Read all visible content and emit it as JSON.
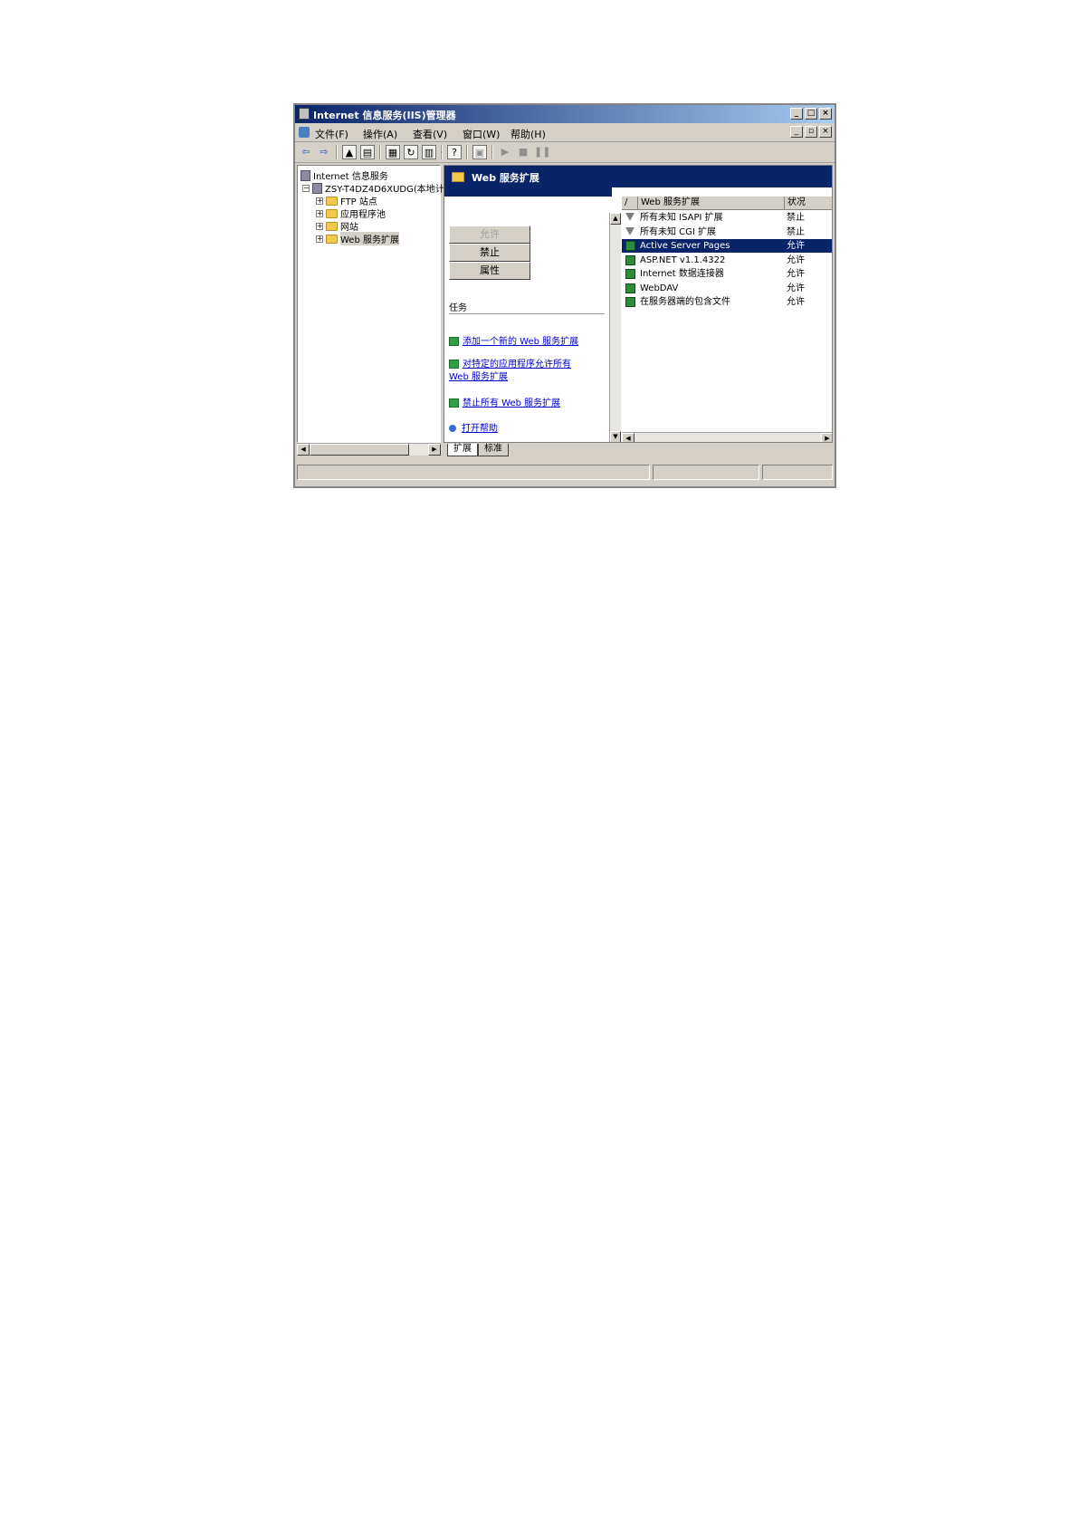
{
  "window": {
    "title": "Internet 信息服务(IIS)管理器",
    "title_buttons": [
      "_",
      "□",
      "×"
    ]
  },
  "menu": {
    "items": [
      "文件(F)",
      "操作(A)",
      "查看(V)",
      "窗口(W)",
      "帮助(H)"
    ],
    "child_buttons": [
      "_",
      "▫",
      "×"
    ]
  },
  "toolbar": {
    "icons": [
      "back-arrow-icon",
      "forward-arrow-icon",
      "up-folder-icon",
      "show-hide-tree-icon",
      "properties-icon",
      "refresh-icon",
      "export-list-icon",
      "help-icon",
      "new-window-icon",
      "play-icon",
      "stop-icon",
      "pause-icon"
    ]
  },
  "tree": {
    "root": "Internet 信息服务",
    "server": "ZSY-T4DZ4D6XUDG(本地计",
    "children": [
      "FTP 站点",
      "应用程序池",
      "网站",
      "Web 服务扩展"
    ]
  },
  "content": {
    "banner_title": "Web 服务扩展",
    "buttons": {
      "allow": "允许",
      "prohibit": "禁止",
      "properties": "属性"
    },
    "tasks_heading": "任务",
    "tasks": [
      "添加一个新的 Web 服务扩展",
      "对特定的应用程序允许所有",
      "Web 服务扩展",
      "禁止所有 Web 服务扩展",
      "打开帮助"
    ]
  },
  "list": {
    "columns": [
      "/",
      "Web 服务扩展",
      "状况"
    ],
    "rows": [
      {
        "name": "所有未知 ISAPI 扩展",
        "status": "禁止",
        "icon": "filter-icon"
      },
      {
        "name": "所有未知 CGI 扩展",
        "status": "禁止",
        "icon": "filter-icon"
      },
      {
        "name": "Active Server Pages",
        "status": "允许",
        "icon": "extension-icon",
        "selected": true
      },
      {
        "name": "ASP.NET v1.1.4322",
        "status": "允许",
        "icon": "extension-icon"
      },
      {
        "name": "Internet 数据连接器",
        "status": "允许",
        "icon": "extension-icon"
      },
      {
        "name": "WebDAV",
        "status": "允许",
        "icon": "extension-icon"
      },
      {
        "name": "在服务器端的包含文件",
        "status": "允许",
        "icon": "extension-icon"
      }
    ]
  },
  "tabs": [
    "扩展",
    "标准"
  ],
  "colors": {
    "title_start": "#0a246a",
    "title_end": "#a6caf0",
    "selection": "#0a246a",
    "face": "#d4d0c8",
    "link": "#0000cc"
  }
}
